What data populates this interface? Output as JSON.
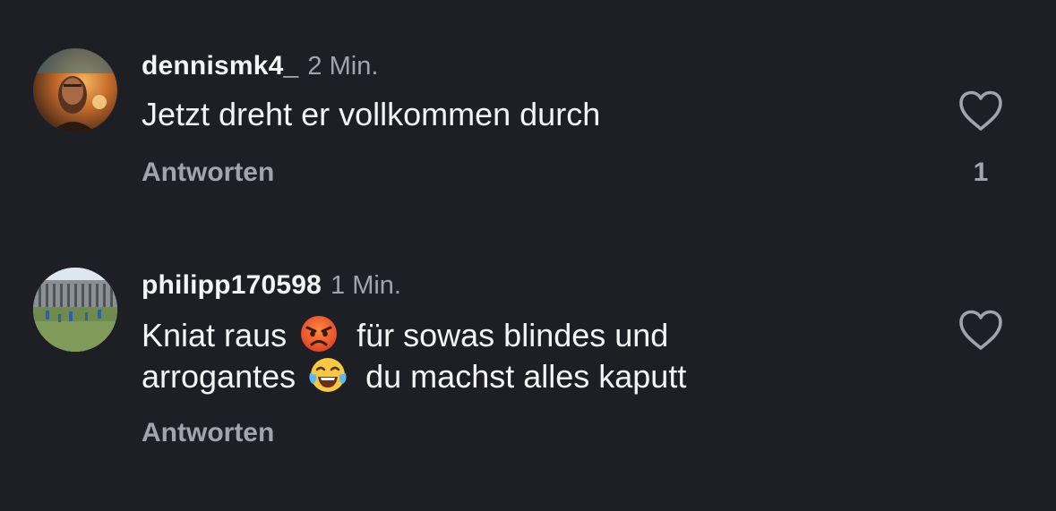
{
  "comments": [
    {
      "username": "dennismk4_",
      "time": "2 Min.",
      "line1": "Jetzt dreht er vollkommen durch",
      "reply_label": "Antworten",
      "like_count": "1"
    },
    {
      "username": "philipp170598",
      "time": "1 Min.",
      "line1_a": "Kniat raus",
      "line1_b": "für sowas blindes und",
      "line2_a": "arrogantes",
      "line2_b": "du machst alles kaputt",
      "reply_label": "Antworten"
    }
  ],
  "icons": {
    "like": "heart-outline-icon",
    "emoji_1": "angry-face-emoji",
    "emoji_2": "tears-of-joy-emoji"
  },
  "colors": {
    "background": "#1e1f24",
    "text": "#f4f4f6",
    "secondary": "#a3a4ab"
  }
}
